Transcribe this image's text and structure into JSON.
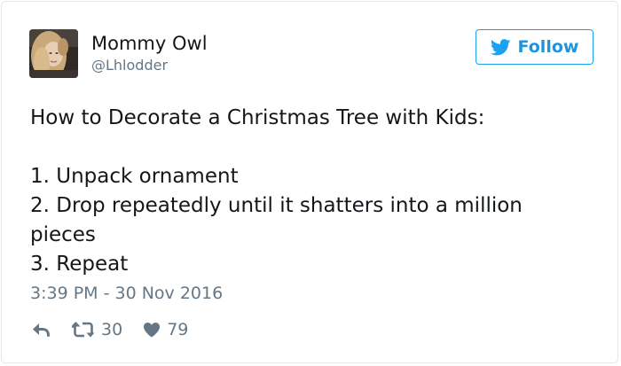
{
  "tweet": {
    "author": {
      "display_name": "Mommy Owl",
      "handle": "@Lhlodder",
      "avatar_icon": "user-avatar-photo"
    },
    "follow_button": {
      "label": "Follow",
      "icon": "twitter-bird-icon",
      "color": "#1da1f2"
    },
    "text_lines": [
      "How to Decorate a Christmas Tree with Kids:",
      "",
      "1. Unpack ornament",
      "2. Drop repeatedly until it shatters into a million",
      "pieces",
      "3. Repeat"
    ],
    "timestamp": "3:39 PM - 30 Nov 2016",
    "actions": {
      "reply": {
        "icon": "reply-icon"
      },
      "retweet": {
        "icon": "retweet-icon",
        "count": "30"
      },
      "like": {
        "icon": "heart-icon",
        "count": "79"
      }
    }
  }
}
